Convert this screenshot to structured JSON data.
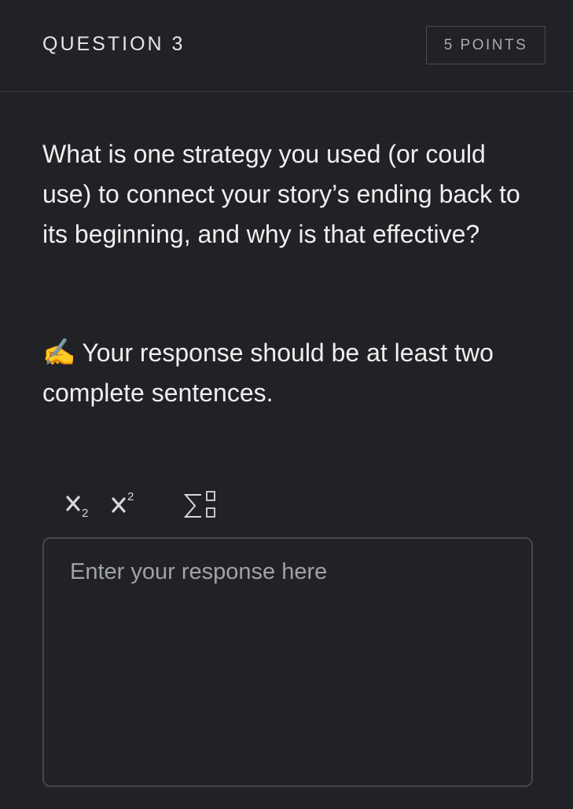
{
  "header": {
    "question_label": "QUESTION 3",
    "points_label": "5 POINTS"
  },
  "question": {
    "prompt": "What is one strategy you used (or could use) to connect your story’s ending back to its beginning, and why is that effective?",
    "instruction_emoji": "✍️",
    "instruction_text": "Your response should be at least two complete sentences."
  },
  "toolbar": {
    "items": [
      {
        "name": "subscript",
        "icon": "subscript-icon"
      },
      {
        "name": "superscript",
        "icon": "superscript-icon"
      },
      {
        "name": "equation",
        "icon": "sigma-equation-icon"
      }
    ]
  },
  "response": {
    "placeholder": "Enter your response here",
    "value": ""
  },
  "colors": {
    "background": "#212225",
    "text": "#efefef",
    "muted": "#a9abb0",
    "border": "#46474c"
  }
}
